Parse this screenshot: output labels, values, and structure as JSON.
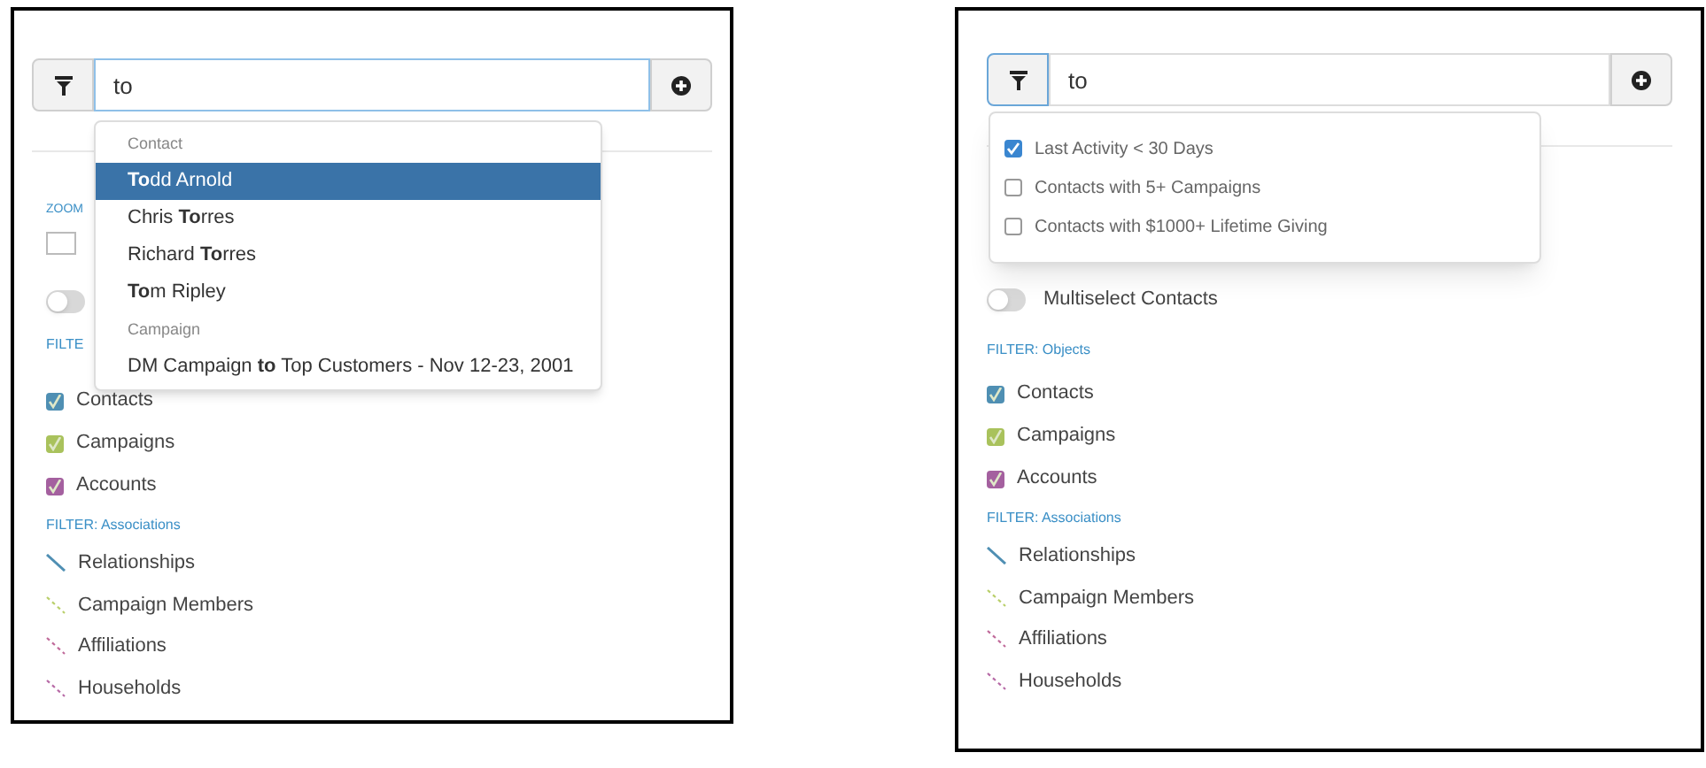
{
  "panels": [
    {
      "search": {
        "value": "to",
        "input_focused": true,
        "filter_focused": false
      },
      "suggestions": [
        {
          "heading": "Contact",
          "items": [
            {
              "text": "**To**dd Arnold",
              "selected": true
            },
            {
              "text": "Chris **To**rres",
              "selected": false
            },
            {
              "text": "Richard **To**rres",
              "selected": false
            },
            {
              "text": "**To**m Ripley",
              "selected": false
            }
          ]
        },
        {
          "heading": "Campaign",
          "items": [
            {
              "text": "DM Campaign **to** Top Customers - Nov 12-23, 2001",
              "selected": false
            }
          ]
        }
      ],
      "zoom_label": "ZOOM",
      "toggle": {
        "on": false
      },
      "objects_heading": "FILTE",
      "objects": [
        {
          "label": "Contacts",
          "checked": true,
          "color": "#4f8fb3"
        },
        {
          "label": "Campaigns",
          "checked": true,
          "color": "#a9c25c"
        },
        {
          "label": "Accounts",
          "checked": true,
          "color": "#a4609f"
        }
      ],
      "associations_heading": "FILTER: Associations",
      "associations": [
        {
          "label": "Relationships",
          "kind": "solid",
          "color": "#4f8fb3"
        },
        {
          "label": "Campaign Members",
          "kind": "dashed",
          "color": "#b9cf6a"
        },
        {
          "label": "Affiliations",
          "kind": "dashed",
          "color": "#c06a9a"
        },
        {
          "label": "Households",
          "kind": "dashed",
          "color": "#b76aa6"
        }
      ]
    },
    {
      "search": {
        "value": "to",
        "input_focused": false,
        "filter_focused": true
      },
      "filter_menu": [
        {
          "label": "Last Activity < 30 Days",
          "checked": true
        },
        {
          "label": "Contacts with 5+ Campaigns",
          "checked": false
        },
        {
          "label": "Contacts with $1000+ Lifetime Giving",
          "checked": false
        }
      ],
      "toggle": {
        "on": false,
        "label": "Multiselect Contacts"
      },
      "objects_heading": "FILTER: Objects",
      "objects": [
        {
          "label": "Contacts",
          "checked": true,
          "color": "#4f8fb3"
        },
        {
          "label": "Campaigns",
          "checked": true,
          "color": "#a9c25c"
        },
        {
          "label": "Accounts",
          "checked": true,
          "color": "#a4609f"
        }
      ],
      "associations_heading": "FILTER: Associations",
      "associations": [
        {
          "label": "Relationships",
          "kind": "solid",
          "color": "#4f8fb3"
        },
        {
          "label": "Campaign Members",
          "kind": "dashed",
          "color": "#b9cf6a"
        },
        {
          "label": "Affiliations",
          "kind": "dashed",
          "color": "#c06a9a"
        },
        {
          "label": "Households",
          "kind": "dashed",
          "color": "#b76aa6"
        }
      ]
    }
  ]
}
